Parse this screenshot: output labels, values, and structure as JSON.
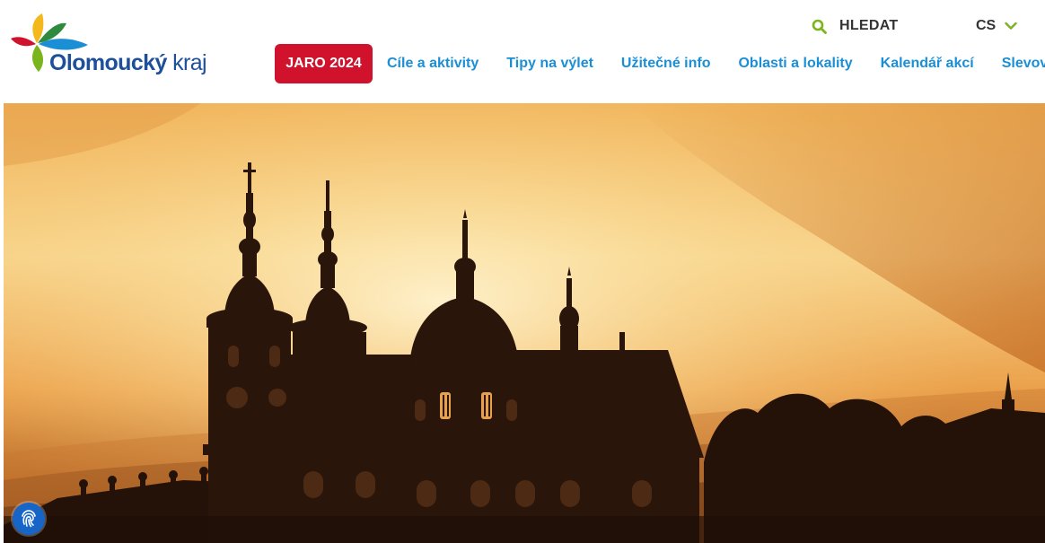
{
  "brand": {
    "name_strong": "Olomoucký",
    "name_light": "kraj"
  },
  "utility": {
    "search_label": "HLEDAT",
    "language": "CS"
  },
  "nav": {
    "highlight_label": "JARO 2024",
    "items": [
      {
        "label": "Cíle a aktivity"
      },
      {
        "label": "Tipy na výlet"
      },
      {
        "label": "Užitečné info"
      },
      {
        "label": "Oblasti a lokality"
      },
      {
        "label": "Kalendář akcí"
      },
      {
        "label": "Slevová karta"
      }
    ]
  },
  "hero": {
    "image": "sunset-church-silhouette"
  },
  "icons": {
    "search": "search-icon",
    "language_toggle": "chevron-down-icon",
    "accessibility": "fingerprint-icon"
  },
  "colors": {
    "brand_blue": "#1d4f9a",
    "nav_link": "#1a8fd6",
    "highlight": "#d0122d",
    "accent_green": "#7ab51d",
    "a11y_button": "#1665c7"
  }
}
